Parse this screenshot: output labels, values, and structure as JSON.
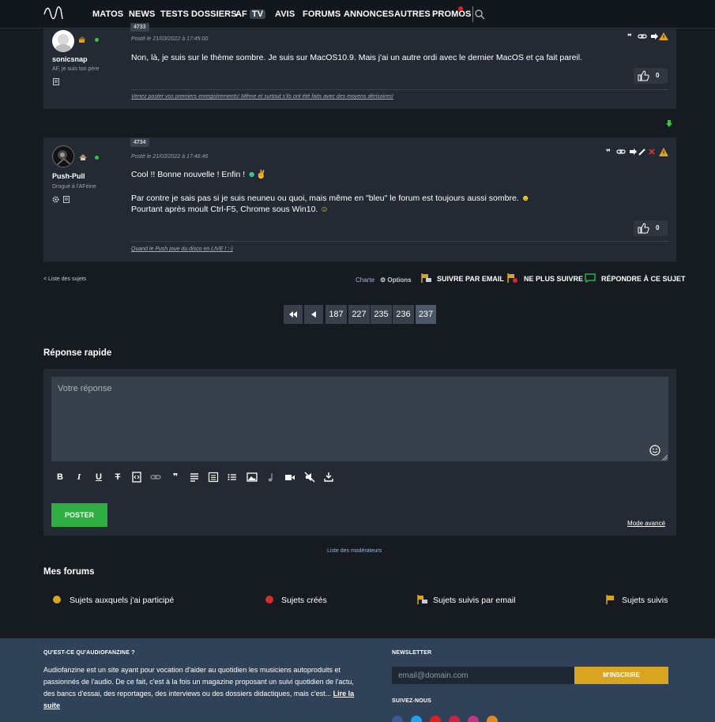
{
  "nav": {
    "items": [
      "MATOS",
      "NEWS",
      "TESTS",
      "DOSSIERS",
      "AF",
      "AVIS",
      "FORUMS",
      "ANNONCES",
      "AUTRES",
      "PROMOS"
    ],
    "tv_badge": "TV"
  },
  "posts": [
    {
      "number": "4733",
      "username": "sonicsnap",
      "user_title": "AF, je suis ton père",
      "date": "Posté le 21/03/2022 à 17:45:00",
      "lines": [
        "Non, là, je suis sur le thème sombre. Je suis sur MacOS10.9. Mais j'ai un autre ordi avec le dernier MacOS et ça fait pareil."
      ],
      "likes": "0",
      "signature": "Venez poster vos premiers enregistrements! Même et surtout s'ils ont été faits avec des moyens dérisoires!"
    },
    {
      "number": "4734",
      "username": "Push-Pull",
      "user_title": "Drogué à l'AFéine",
      "date": "Posté le 21/03/2022 à 17:46:46",
      "lines": [
        "Cool !! Bonne nouvelle ! Enfin !",
        "Par contre je sais pas si je suis neuneu ou quoi, mais même en \"bleu\" le forum est toujours aussi sombre.",
        "Pourtant après moult Ctrl-F5, Chrome sous Win10."
      ],
      "likes": "0",
      "signature": "Quand le Push joue du disco en LIVE ! :-)"
    }
  ],
  "thread_tools": {
    "back": "< Liste des sujets",
    "charter": "Charte",
    "options": "Options",
    "follow_email": "SUIVRE PAR EMAIL",
    "unfollow": "NE PLUS SUIVRE",
    "reply": "RÉPONDRE À CE SUJET"
  },
  "pagination": {
    "pages": [
      "187",
      "227",
      "235",
      "236",
      "237"
    ],
    "current": "237"
  },
  "quick_reply": {
    "title": "Réponse rapide",
    "placeholder": "Votre réponse",
    "toolbar": [
      "bold-icon",
      "italic-icon",
      "underline-icon",
      "strikethrough-icon",
      "code-icon",
      "link-icon",
      "quote-icon",
      "align-icon",
      "list-numbered-icon",
      "list-icon",
      "image-icon",
      "audio-icon",
      "video-icon",
      "no-audio-icon",
      "download-icon"
    ],
    "post_label": "POSTER",
    "advanced_mode": "Mode avancé"
  },
  "moderators_link": "Liste des modérateurs",
  "my_forums": {
    "title": "Mes forums",
    "items": [
      "Sujets auxquels j'ai participé",
      "Sujets créés",
      "Sujets suivis par email",
      "Sujets suivis"
    ],
    "colors": [
      "#d9a520",
      "#d42b2b",
      "#d9a520",
      "#d9a520"
    ]
  },
  "footer": {
    "about_title": "QU'EST-CE QU'AUDIOFANZINE ?",
    "about_text": "Audiofanzine est un site ayant pour vocation d'aider au quotidien les musiciens autoproduits et passionnés de l'audio. De ce fait, c'est à la fois un magazine proposant un suivi quotidien de l'actu, des bancs d'essai, des reportages, des interviews ou des dossiers didactiques, mais c'est...",
    "read_more": "Lire la suite",
    "newsletter_title": "NEWSLETTER",
    "email_placeholder": "email@domain.com",
    "subscribe": "M'INSCRIRE",
    "follow_title": "SUIVEZ-NOUS"
  },
  "colors": {
    "accent_green": "#2fae43",
    "accent_gold": "#d9a520",
    "alert_red": "#d42b2b"
  }
}
